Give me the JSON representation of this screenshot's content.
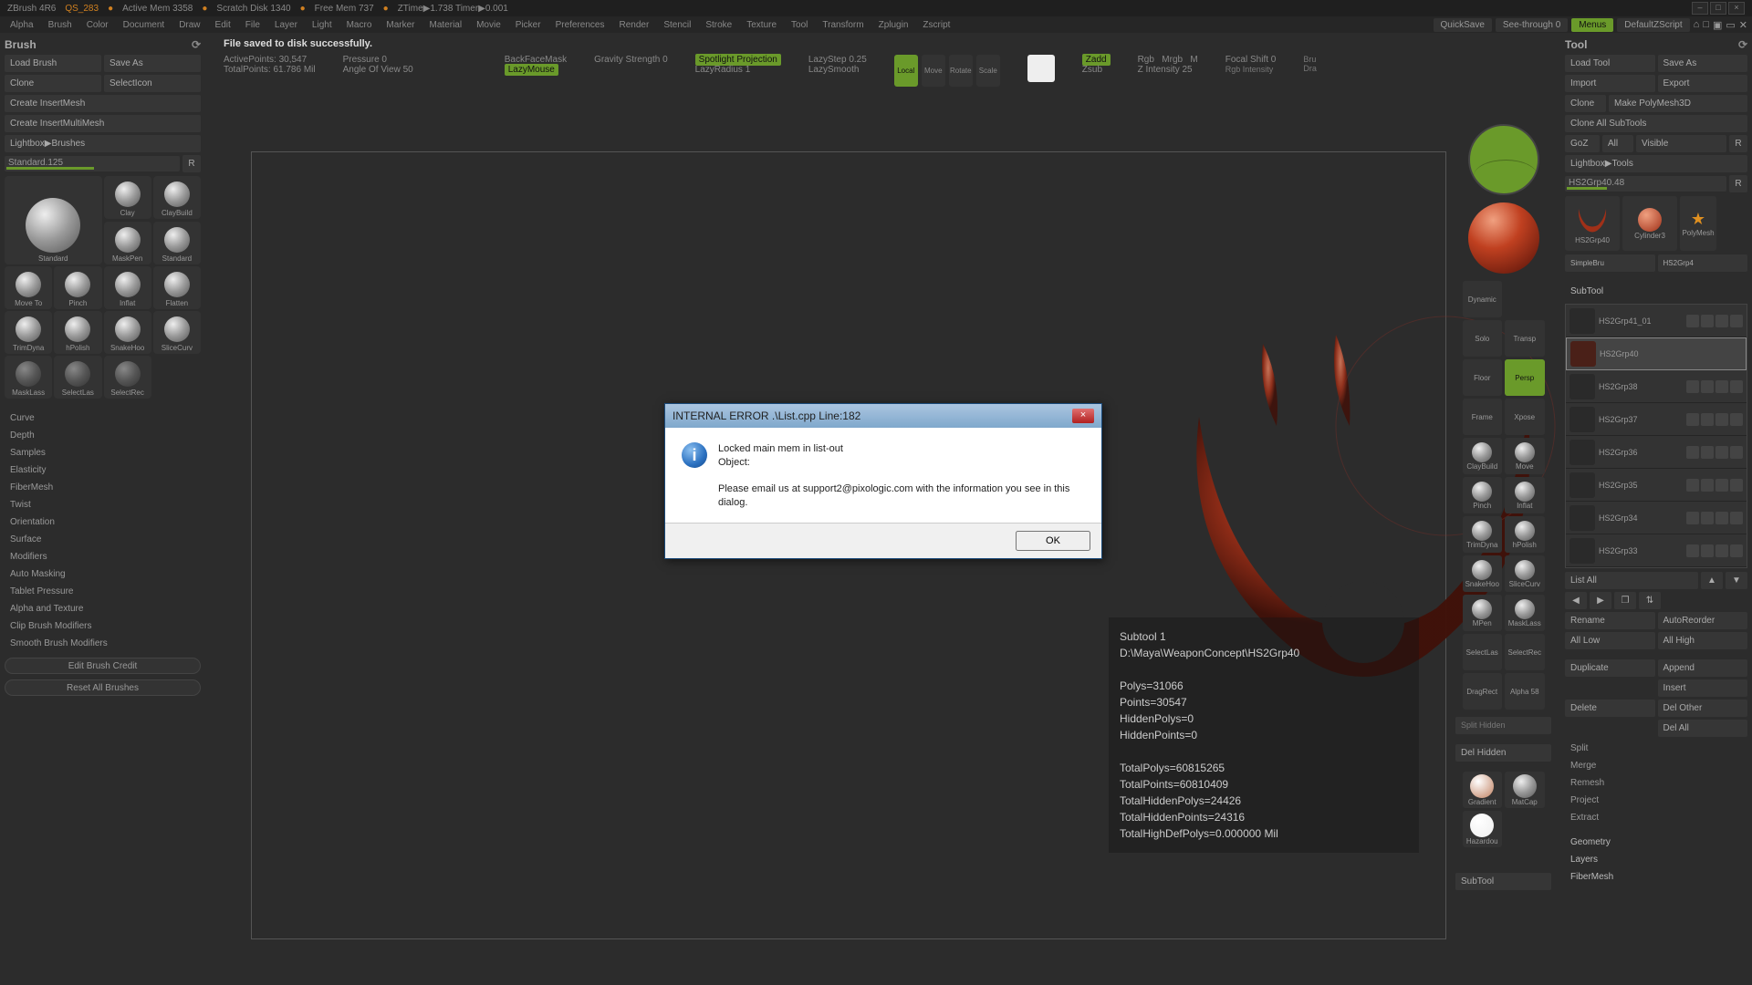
{
  "titlebar": {
    "app": "ZBrush 4R6",
    "doc": "QS_283",
    "mem": "Active Mem 3358",
    "scratch": "Scratch Disk 1340",
    "free": "Free Mem 737",
    "ztime": "ZTime▶1.738 Timer▶0.001"
  },
  "menubar": {
    "items": [
      "Alpha",
      "Brush",
      "Color",
      "Document",
      "Draw",
      "Edit",
      "File",
      "Layer",
      "Light",
      "Macro",
      "Marker",
      "Material",
      "Movie",
      "Picker",
      "Preferences",
      "Render",
      "Stencil",
      "Stroke",
      "Texture",
      "Tool",
      "Transform",
      "Zplugin",
      "Zscript"
    ],
    "quicksave": "QuickSave",
    "seethrough": "See-through  0",
    "menus": "Menus",
    "defzscript": "DefaultZScript"
  },
  "left": {
    "title": "Brush",
    "btns": {
      "load": "Load Brush",
      "saveas": "Save As",
      "clone": "Clone",
      "selicon": "SelectIcon",
      "cim": "Create InsertMesh",
      "cimm": "Create InsertMultiMesh",
      "lightbox": "Lightbox▶Brushes"
    },
    "slider": "Standard.125",
    "brushes": [
      "Standard",
      "Clay",
      "ClayBuild",
      "MaskPen",
      "Standard",
      "Move To",
      "Pinch",
      "Inflat",
      "Flatten",
      "TrimDyna",
      "hPolish",
      "SnakeHoo",
      "SliceCurv",
      "MaskLass",
      "SelectLas",
      "SelectRec"
    ],
    "sections": [
      "Curve",
      "Depth",
      "Samples",
      "Elasticity",
      "FiberMesh",
      "Twist",
      "Orientation",
      "Surface",
      "Modifiers",
      "Auto Masking",
      "Tablet Pressure",
      "Alpha and Texture",
      "Clip Brush Modifiers",
      "Smooth Brush Modifiers"
    ],
    "editcredit": "Edit Brush Credit",
    "reset": "Reset All Brushes"
  },
  "center": {
    "status": "File saved to disk successfully.",
    "activepoints": "ActivePoints: 30,547",
    "totalpoints": "TotalPoints: 61.786 Mil",
    "pressure": "Pressure 0",
    "aov": "Angle Of View 50",
    "backface": "BackFaceMask",
    "lazymouse": "LazyMouse",
    "gravity": "Gravity Strength 0",
    "spotlight": "Spotlight Projection",
    "lazyradius": "LazyRadius 1",
    "lazystep": "LazyStep 0.25",
    "lazysmooth": "LazySmooth",
    "local": "Local",
    "move": "Move",
    "rotate": "Rotate",
    "scale": "Scale",
    "zadd": "Zadd",
    "zsub": "Zsub",
    "rgb": "Rgb",
    "mrgb": "Mrgb",
    "m": "M",
    "zintensity": "Z Intensity 25",
    "focalshift": "Focal Shift 0",
    "rgbint": "Rgb Intensity",
    "bru": "Bru",
    "dra": "Dra"
  },
  "overlay": {
    "subtool": "Subtool 1",
    "path": "D:\\Maya\\WeaponConcept\\HS2Grp40",
    "polys": "Polys=31066",
    "points": "Points=30547",
    "hpolys": "HiddenPolys=0",
    "hpoints": "HiddenPoints=0",
    "tpolys": "TotalPolys=60815265",
    "tpoints": "TotalPoints=60810409",
    "thpolys": "TotalHiddenPolys=24426",
    "thpoints": "TotalHiddenPoints=24316",
    "thd": "TotalHighDefPolys=0.000000 Mil"
  },
  "strip": {
    "cells": [
      "Dynamic",
      "Solo",
      "Transp",
      "Floor",
      "Persp",
      "Frame",
      "Xpose",
      "ClayBuild",
      "Move",
      "Pinch",
      "Inflat",
      "TrimDyna",
      "hPolish",
      "SnakeHoo",
      "SliceCurv",
      "MPen",
      "MaskLass",
      "SelectLas",
      "SelectRec",
      "DragRect",
      "Alpha 58"
    ],
    "splith": "Split Hidden",
    "delh": "Del Hidden",
    "mats": [
      "Gradient",
      "MatCap",
      "Hazardou"
    ],
    "subtool_btn": "SubTool"
  },
  "right": {
    "title": "Tool",
    "btns": {
      "load": "Load Tool",
      "saveas": "Save As",
      "import": "Import",
      "export": "Export",
      "clone": "Clone",
      "makepoly": "Make PolyMesh3D",
      "cloneall": "Clone All SubTools",
      "goz": "GoZ",
      "all": "All",
      "visible": "Visible",
      "lightbox": "Lightbox▶Tools"
    },
    "toolname": "HS2Grp40.48",
    "thumbs": [
      "HS2Grp40",
      "Cylinder3",
      "PolyMesh",
      "SimpleBru",
      "HS2Grp4"
    ],
    "subtool_title": "SubTool",
    "subtools": [
      "HS2Grp41_01",
      "HS2Grp40",
      "HS2Grp38",
      "HS2Grp37",
      "HS2Grp36",
      "HS2Grp35",
      "HS2Grp34",
      "HS2Grp33"
    ],
    "listall": "List All",
    "rename": "Rename",
    "autoreorder": "AutoReorder",
    "alllow": "All Low",
    "allhigh": "All High",
    "duplicate": "Duplicate",
    "append": "Append",
    "insert": "Insert",
    "delete": "Delete",
    "delother": "Del Other",
    "delall": "Del All",
    "split": "Split",
    "merge": "Merge",
    "remesh": "Remesh",
    "project": "Project",
    "extract": "Extract",
    "geom": "Geometry",
    "layers": "Layers",
    "fiber": "FiberMesh"
  },
  "dialog": {
    "title": "INTERNAL ERROR .\\List.cpp  Line:182",
    "msg1": "Locked main mem in list-out",
    "msg2": "Object:",
    "msg3": "Please email us at support2@pixologic.com with the information you see in this dialog.",
    "ok": "OK"
  }
}
